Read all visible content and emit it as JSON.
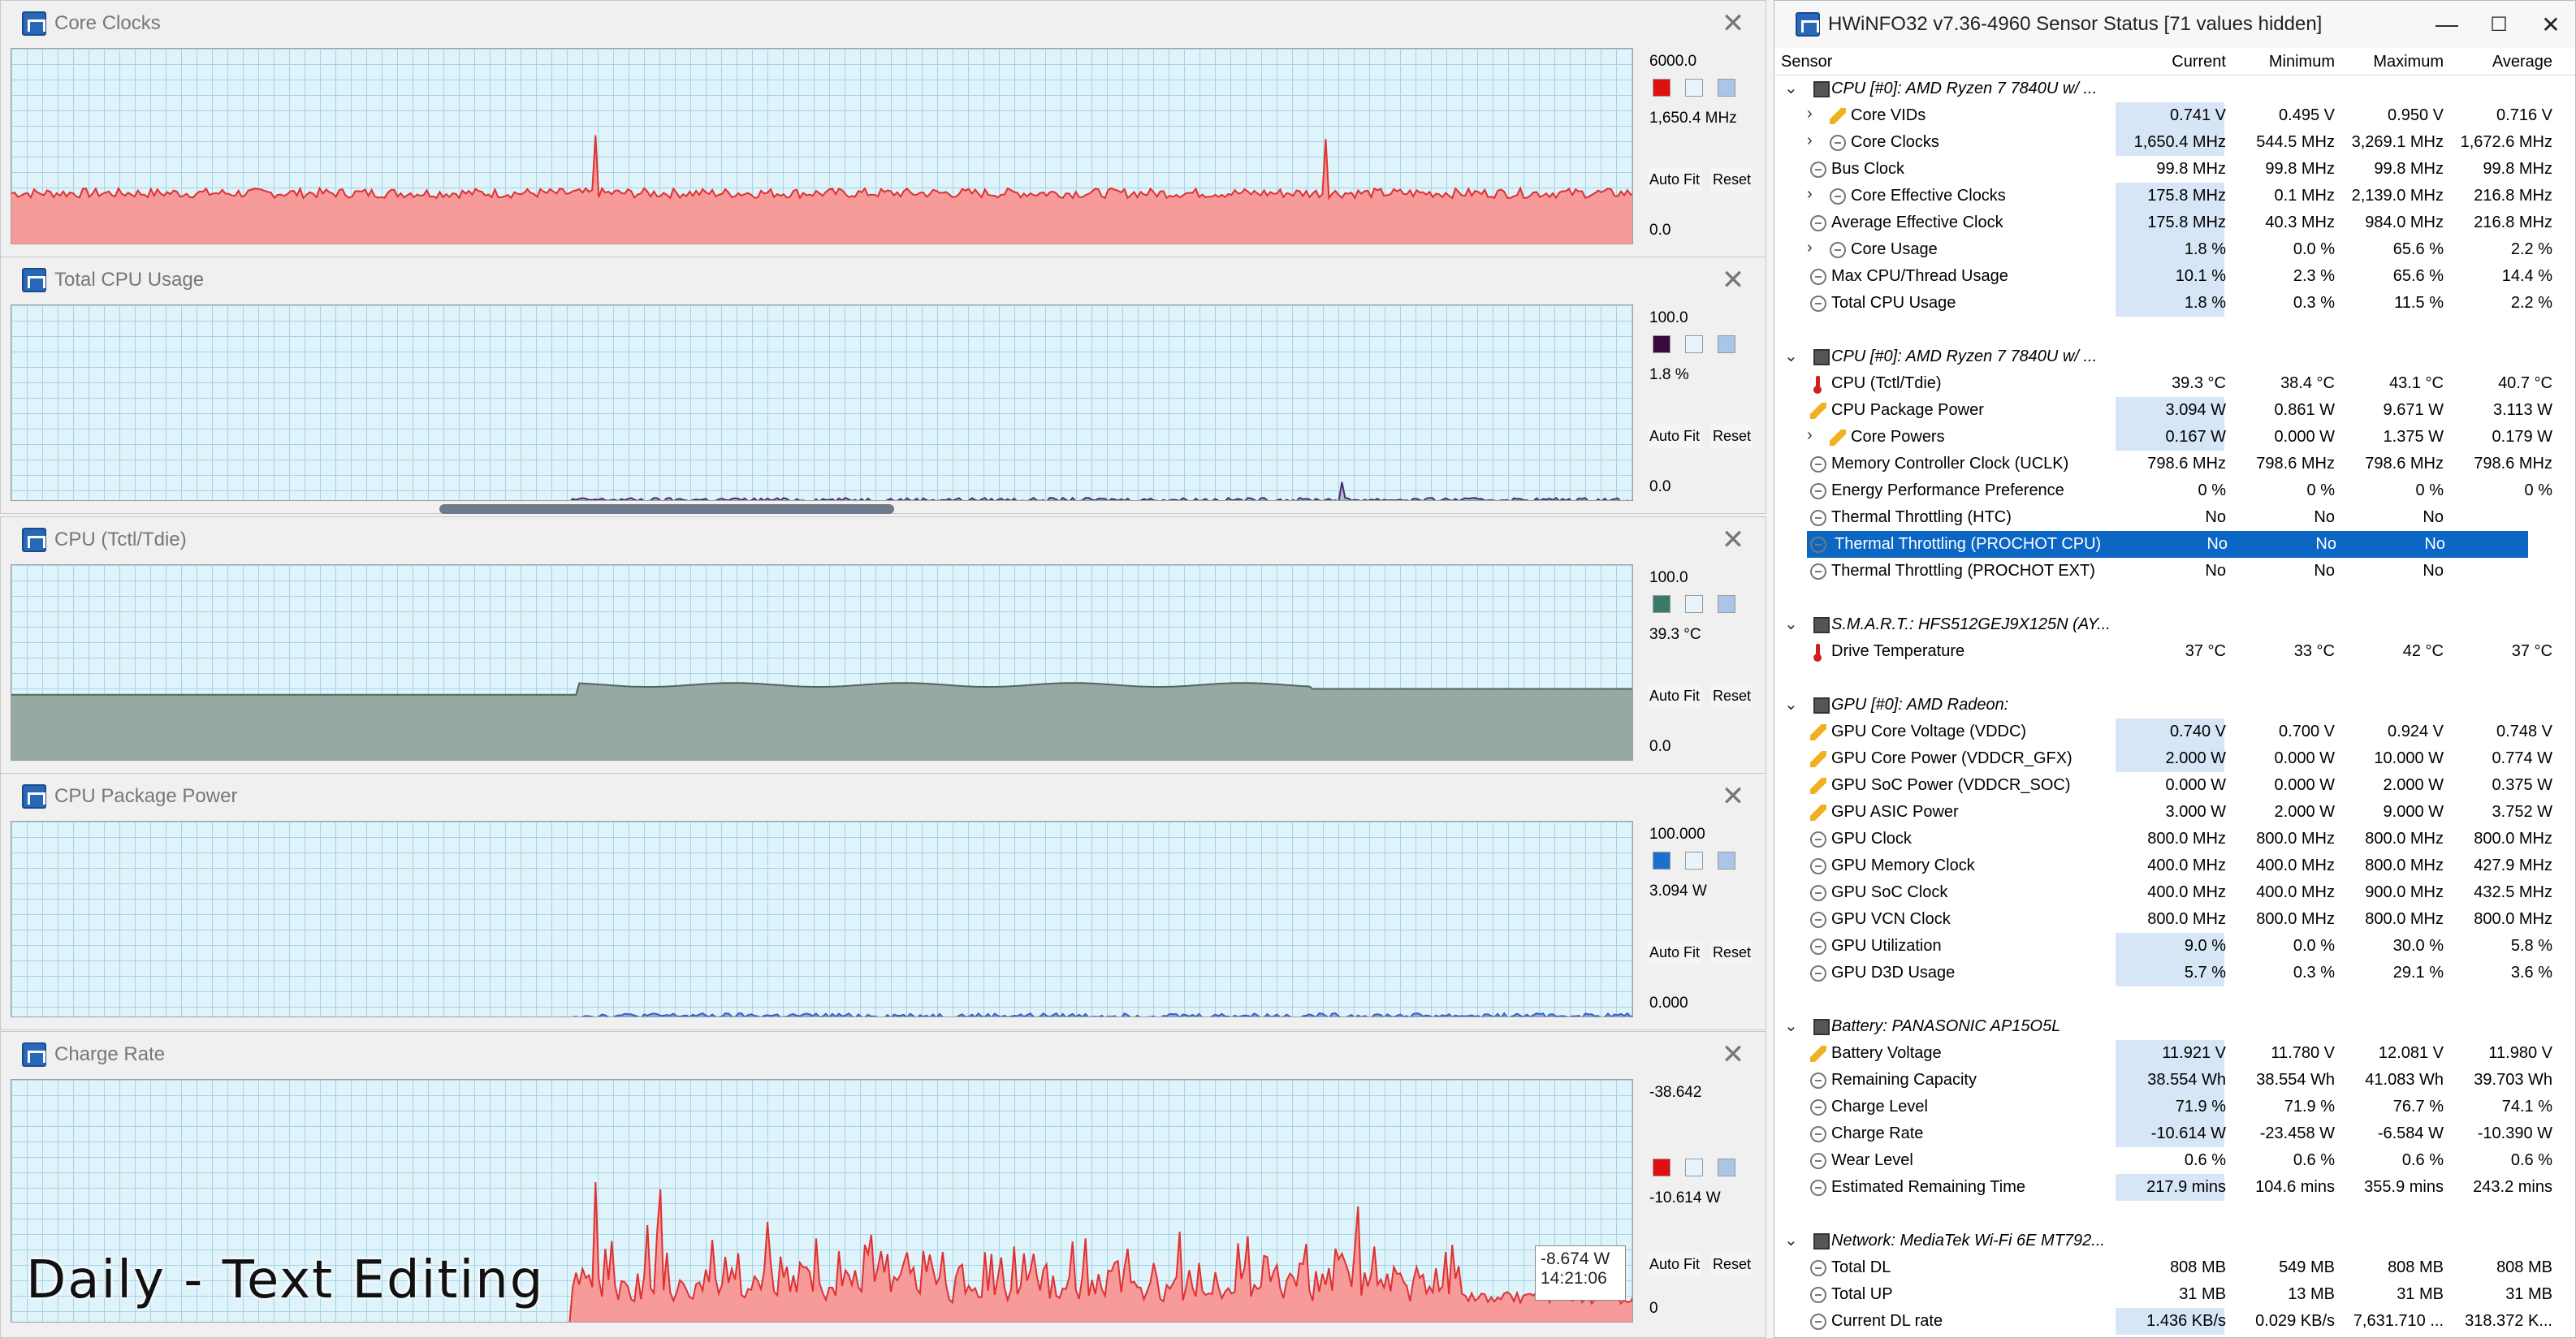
{
  "overlay_text": "Daily - Text Editing",
  "tooltip": {
    "value": "-8.674 W",
    "time": "14:21:06"
  },
  "graphs": [
    {
      "title": "Core Clocks",
      "max": "6000.0",
      "current": "1,650.4 MHz",
      "min": "0.0",
      "color": "#e01010",
      "fill": "#f69a9a",
      "line": "#e03030",
      "base": 0.24,
      "noise": 0.05,
      "spikes": [
        [
          0.36,
          0.56
        ],
        [
          0.81,
          0.54
        ]
      ],
      "autofit": "Auto Fit",
      "reset": "Reset"
    },
    {
      "title": "Total CPU Usage",
      "max": "100.0",
      "current": "1.8 %",
      "min": "0.0",
      "color": "#3a0a3a",
      "fill": "#b9b4d6",
      "line": "#443066",
      "base": 0.0,
      "noise": 0.02,
      "start": 0.345,
      "spikes": [
        [
          0.82,
          0.1
        ]
      ],
      "autofit": "Auto Fit",
      "reset": "Reset"
    },
    {
      "title": "CPU (Tctl/Tdie)",
      "max": "100.0",
      "current": "39.3 °C",
      "min": "0.0",
      "color": "#3a7a6a",
      "fill": "#98a8a2",
      "line": "#4a6a60",
      "base": 0.34,
      "noise": 0.0,
      "bump": [
        0.35,
        0.39
      ],
      "autofit": "Auto Fit",
      "reset": "Reset"
    },
    {
      "title": "CPU Package Power",
      "max": "100.000",
      "current": "3.094 W",
      "min": "0.000",
      "color": "#1a6fd0",
      "fill": "#8fa8e8",
      "line": "#3a60c8",
      "base": 0.0,
      "noise": 0.025,
      "start": 0.345,
      "autofit": "Auto Fit",
      "reset": "Reset"
    },
    {
      "title": "Charge Rate",
      "max": "-38.642",
      "current": "-10.614 W",
      "min": "0",
      "color": "#e01010",
      "fill": "#f69a9a",
      "line": "#e03030",
      "base": 0.08,
      "noise": 0.05,
      "start": 0.345,
      "burst": 0.3,
      "spikes": [
        [
          0.36,
          0.58
        ],
        [
          0.4,
          0.55
        ],
        [
          0.83,
          0.48
        ]
      ],
      "autofit": "Auto Fit",
      "reset": "Reset"
    }
  ],
  "window": {
    "title": "HWiNFO32 v7.36-4960 Sensor Status [71 values hidden]",
    "minimize": "—",
    "maximize": "☐",
    "close": "✕",
    "columns": {
      "sensor": "Sensor",
      "current": "Current",
      "minimum": "Minimum",
      "maximum": "Maximum",
      "average": "Average"
    }
  },
  "rows": [
    {
      "type": "group",
      "name": "CPU [#0]: AMD Ryzen 7 7840U w/ ..."
    },
    {
      "type": "item",
      "icon": "bolt",
      "expand": true,
      "name": "Core VIDs",
      "cur": "0.741 V",
      "min": "0.495 V",
      "max": "0.950 V",
      "avg": "0.716 V",
      "hl": true
    },
    {
      "type": "item",
      "icon": "clock",
      "expand": true,
      "name": "Core Clocks",
      "cur": "1,650.4 MHz",
      "min": "544.5 MHz",
      "max": "3,269.1 MHz",
      "avg": "1,672.6 MHz",
      "hl": true
    },
    {
      "type": "item",
      "icon": "clock",
      "name": "Bus Clock",
      "cur": "99.8 MHz",
      "min": "99.8 MHz",
      "max": "99.8 MHz",
      "avg": "99.8 MHz"
    },
    {
      "type": "item",
      "icon": "clock",
      "expand": true,
      "name": "Core Effective Clocks",
      "cur": "175.8 MHz",
      "min": "0.1 MHz",
      "max": "2,139.0 MHz",
      "avg": "216.8 MHz",
      "hl": true
    },
    {
      "type": "item",
      "icon": "clock",
      "name": "Average Effective Clock",
      "cur": "175.8 MHz",
      "min": "40.3 MHz",
      "max": "984.0 MHz",
      "avg": "216.8 MHz",
      "hl": true
    },
    {
      "type": "item",
      "icon": "clock",
      "expand": true,
      "name": "Core Usage",
      "cur": "1.8 %",
      "min": "0.0 %",
      "max": "65.6 %",
      "avg": "2.2 %",
      "hl": true
    },
    {
      "type": "item",
      "icon": "clock",
      "name": "Max CPU/Thread Usage",
      "cur": "10.1 %",
      "min": "2.3 %",
      "max": "65.6 %",
      "avg": "14.4 %",
      "hl": true
    },
    {
      "type": "item",
      "icon": "clock",
      "name": "Total CPU Usage",
      "cur": "1.8 %",
      "min": "0.3 %",
      "max": "11.5 %",
      "avg": "2.2 %",
      "hl": true
    },
    {
      "type": "blank"
    },
    {
      "type": "group",
      "name": "CPU [#0]: AMD Ryzen 7 7840U w/ ..."
    },
    {
      "type": "item",
      "icon": "therm",
      "name": "CPU (Tctl/Tdie)",
      "cur": "39.3 °C",
      "min": "38.4 °C",
      "max": "43.1 °C",
      "avg": "40.7 °C"
    },
    {
      "type": "item",
      "icon": "bolt",
      "name": "CPU Package Power",
      "cur": "3.094 W",
      "min": "0.861 W",
      "max": "9.671 W",
      "avg": "3.113 W",
      "hl": true
    },
    {
      "type": "item",
      "icon": "bolt",
      "expand": true,
      "name": "Core Powers",
      "cur": "0.167 W",
      "min": "0.000 W",
      "max": "1.375 W",
      "avg": "0.179 W",
      "hl": true
    },
    {
      "type": "item",
      "icon": "clock",
      "name": "Memory Controller Clock (UCLK)",
      "cur": "798.6 MHz",
      "min": "798.6 MHz",
      "max": "798.6 MHz",
      "avg": "798.6 MHz"
    },
    {
      "type": "item",
      "icon": "clock",
      "name": "Energy Performance Preference",
      "cur": "0 %",
      "min": "0 %",
      "max": "0 %",
      "avg": "0 %"
    },
    {
      "type": "item",
      "icon": "clock",
      "name": "Thermal Throttling (HTC)",
      "cur": "No",
      "min": "No",
      "max": "No",
      "avg": ""
    },
    {
      "type": "item",
      "icon": "clock",
      "name": "Thermal Throttling (PROCHOT CPU)",
      "cur": "No",
      "min": "No",
      "max": "No",
      "avg": "",
      "selected": true
    },
    {
      "type": "item",
      "icon": "clock",
      "name": "Thermal Throttling (PROCHOT EXT)",
      "cur": "No",
      "min": "No",
      "max": "No",
      "avg": ""
    },
    {
      "type": "blank"
    },
    {
      "type": "group",
      "name": "S.M.A.R.T.: HFS512GEJ9X125N (AY..."
    },
    {
      "type": "item",
      "icon": "therm",
      "name": "Drive Temperature",
      "cur": "37 °C",
      "min": "33 °C",
      "max": "42 °C",
      "avg": "37 °C"
    },
    {
      "type": "blank"
    },
    {
      "type": "group",
      "name": "GPU [#0]: AMD Radeon:"
    },
    {
      "type": "item",
      "icon": "bolt",
      "name": "GPU Core Voltage (VDDC)",
      "cur": "0.740 V",
      "min": "0.700 V",
      "max": "0.924 V",
      "avg": "0.748 V",
      "hl": true
    },
    {
      "type": "item",
      "icon": "bolt",
      "name": "GPU Core Power (VDDCR_GFX)",
      "cur": "2.000 W",
      "min": "0.000 W",
      "max": "10.000 W",
      "avg": "0.774 W",
      "hl": true
    },
    {
      "type": "item",
      "icon": "bolt",
      "name": "GPU SoC Power (VDDCR_SOC)",
      "cur": "0.000 W",
      "min": "0.000 W",
      "max": "2.000 W",
      "avg": "0.375 W"
    },
    {
      "type": "item",
      "icon": "bolt",
      "name": "GPU ASIC Power",
      "cur": "3.000 W",
      "min": "2.000 W",
      "max": "9.000 W",
      "avg": "3.752 W"
    },
    {
      "type": "item",
      "icon": "clock",
      "name": "GPU Clock",
      "cur": "800.0 MHz",
      "min": "800.0 MHz",
      "max": "800.0 MHz",
      "avg": "800.0 MHz"
    },
    {
      "type": "item",
      "icon": "clock",
      "name": "GPU Memory Clock",
      "cur": "400.0 MHz",
      "min": "400.0 MHz",
      "max": "800.0 MHz",
      "avg": "427.9 MHz"
    },
    {
      "type": "item",
      "icon": "clock",
      "name": "GPU SoC Clock",
      "cur": "400.0 MHz",
      "min": "400.0 MHz",
      "max": "900.0 MHz",
      "avg": "432.5 MHz"
    },
    {
      "type": "item",
      "icon": "clock",
      "name": "GPU VCN Clock",
      "cur": "800.0 MHz",
      "min": "800.0 MHz",
      "max": "800.0 MHz",
      "avg": "800.0 MHz"
    },
    {
      "type": "item",
      "icon": "clock",
      "name": "GPU Utilization",
      "cur": "9.0 %",
      "min": "0.0 %",
      "max": "30.0 %",
      "avg": "5.8 %",
      "hl": true
    },
    {
      "type": "item",
      "icon": "clock",
      "name": "GPU D3D Usage",
      "cur": "5.7 %",
      "min": "0.3 %",
      "max": "29.1 %",
      "avg": "3.6 %",
      "hl": true
    },
    {
      "type": "blank"
    },
    {
      "type": "group",
      "name": "Battery: PANASONIC AP15O5L"
    },
    {
      "type": "item",
      "icon": "bolt",
      "name": "Battery Voltage",
      "cur": "11.921 V",
      "min": "11.780 V",
      "max": "12.081 V",
      "avg": "11.980 V",
      "hl": true
    },
    {
      "type": "item",
      "icon": "clock",
      "name": "Remaining Capacity",
      "cur": "38.554 Wh",
      "min": "38.554 Wh",
      "max": "41.083 Wh",
      "avg": "39.703 Wh",
      "hl": true
    },
    {
      "type": "item",
      "icon": "clock",
      "name": "Charge Level",
      "cur": "71.9 %",
      "min": "71.9 %",
      "max": "76.7 %",
      "avg": "74.1 %",
      "hl": true
    },
    {
      "type": "item",
      "icon": "clock",
      "name": "Charge Rate",
      "cur": "-10.614 W",
      "min": "-23.458 W",
      "max": "-6.584 W",
      "avg": "-10.390 W",
      "hl": true
    },
    {
      "type": "item",
      "icon": "clock",
      "name": "Wear Level",
      "cur": "0.6 %",
      "min": "0.6 %",
      "max": "0.6 %",
      "avg": "0.6 %"
    },
    {
      "type": "item",
      "icon": "clock",
      "name": "Estimated Remaining Time",
      "cur": "217.9 mins",
      "min": "104.6 mins",
      "max": "355.9 mins",
      "avg": "243.2 mins",
      "hl": true
    },
    {
      "type": "blank"
    },
    {
      "type": "group",
      "name": "Network: MediaTek Wi-Fi 6E MT792..."
    },
    {
      "type": "item",
      "icon": "clock",
      "name": "Total DL",
      "cur": "808 MB",
      "min": "549 MB",
      "max": "808 MB",
      "avg": "808 MB"
    },
    {
      "type": "item",
      "icon": "clock",
      "name": "Total UP",
      "cur": "31 MB",
      "min": "13 MB",
      "max": "31 MB",
      "avg": "31 MB"
    },
    {
      "type": "item",
      "icon": "clock",
      "name": "Current DL rate",
      "cur": "1.436 KB/s",
      "min": "0.029 KB/s",
      "max": "7,631.710 ...",
      "avg": "318.372 K...",
      "hl": true
    }
  ]
}
